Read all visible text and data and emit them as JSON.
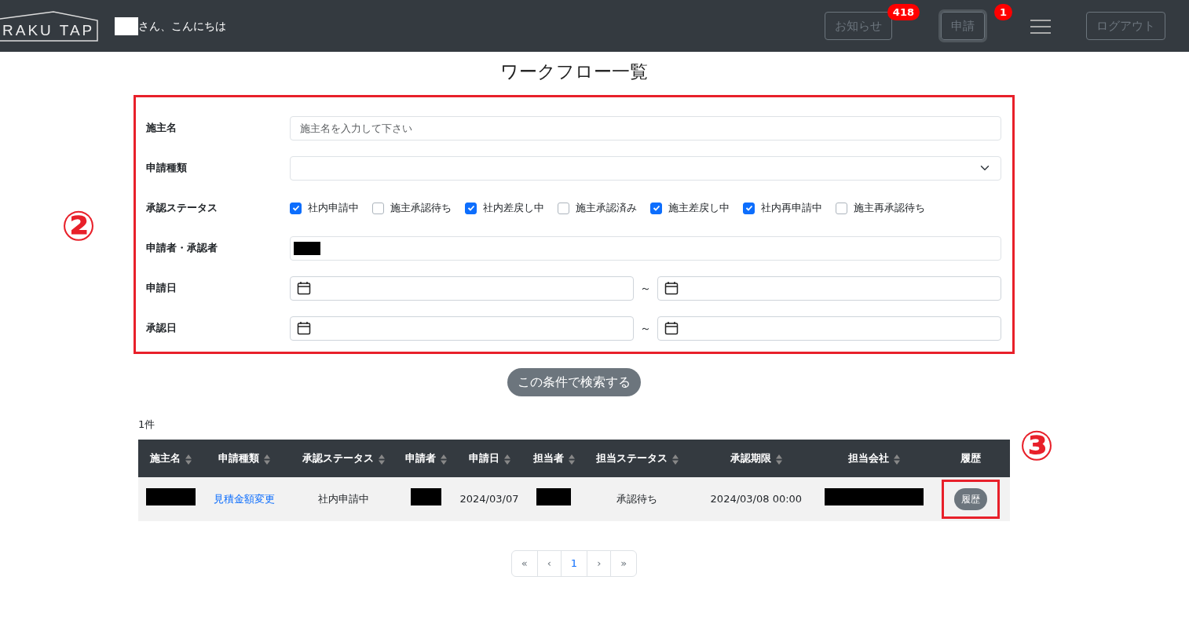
{
  "navbar": {
    "logo": "RAKU TAP",
    "greeting": "さん、こんにちは",
    "buttons": [
      {
        "label": "お知らせ",
        "badge": "418",
        "focused": false
      },
      {
        "label": "申請",
        "badge": "1",
        "focused": true
      }
    ],
    "logout": "ログアウト"
  },
  "title": "ワークフロー一覧",
  "form": {
    "annotation": "②",
    "fields": [
      {
        "kind": "text",
        "label": "施主名",
        "placeholder": "施主名を入力して下さい"
      },
      {
        "kind": "select",
        "label": "申請種類"
      },
      {
        "kind": "checks",
        "label": "承認ステータス",
        "options": [
          {
            "label": "社内申請中",
            "checked": true
          },
          {
            "label": "施主承認待ち",
            "checked": false
          },
          {
            "label": "社内差戻し中",
            "checked": true
          },
          {
            "label": "施主承認済み",
            "checked": false
          },
          {
            "label": "施主差戻し中",
            "checked": true
          },
          {
            "label": "社内再申請中",
            "checked": true
          },
          {
            "label": "施主再承認待ち",
            "checked": false
          }
        ]
      },
      {
        "kind": "redacted",
        "label": "申請者・承認者"
      },
      {
        "kind": "daterange",
        "label": "申請日",
        "separator": "～"
      },
      {
        "kind": "daterange",
        "label": "承認日",
        "separator": "～"
      }
    ]
  },
  "search_button": "この条件で検索する",
  "count": "1件",
  "table": {
    "columns": [
      {
        "label": "施主名",
        "sortable": true
      },
      {
        "label": "申請種類",
        "sortable": true
      },
      {
        "label": "承認ステータス",
        "sortable": true
      },
      {
        "label": "申請者",
        "sortable": true
      },
      {
        "label": "申請日",
        "sortable": true
      },
      {
        "label": "担当者",
        "sortable": true
      },
      {
        "label": "担当ステータス",
        "sortable": true
      },
      {
        "label": "承認期限",
        "sortable": true
      },
      {
        "label": "担当会社",
        "sortable": true
      },
      {
        "label": "履歴",
        "sortable": false
      }
    ],
    "rows": [
      {
        "cells": [
          {
            "kind": "redacted"
          },
          {
            "kind": "link",
            "text": "見積金額変更"
          },
          {
            "kind": "text",
            "text": "社内申請中"
          },
          {
            "kind": "redacted"
          },
          {
            "kind": "text",
            "text": "2024/03/07"
          },
          {
            "kind": "redacted"
          },
          {
            "kind": "text",
            "text": "承認待ち"
          },
          {
            "kind": "text",
            "text": "2024/03/08 00:00"
          },
          {
            "kind": "redacted"
          },
          {
            "kind": "button",
            "text": "履歴",
            "highlighted": true
          }
        ]
      }
    ],
    "annotation": "③"
  },
  "pagination": [
    {
      "label": "«",
      "selected": false
    },
    {
      "label": "‹",
      "selected": false
    },
    {
      "label": "1",
      "selected": true
    },
    {
      "label": "›",
      "selected": false
    },
    {
      "label": "»",
      "selected": false
    }
  ]
}
